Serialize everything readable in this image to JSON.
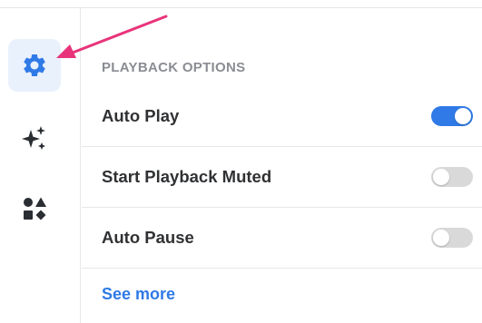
{
  "sidebar": {
    "items": [
      {
        "name": "settings",
        "icon": "gear-icon",
        "active": true
      },
      {
        "name": "effects",
        "icon": "sparkles-icon",
        "active": false
      },
      {
        "name": "shapes",
        "icon": "shapes-icon",
        "active": false
      }
    ]
  },
  "playback": {
    "section_title": "PLAYBACK OPTIONS",
    "options": [
      {
        "label": "Auto Play",
        "enabled": true
      },
      {
        "label": "Start Playback Muted",
        "enabled": false
      },
      {
        "label": "Auto Pause",
        "enabled": false
      }
    ],
    "see_more": "See more"
  },
  "colors": {
    "accent": "#2f7ae6",
    "annotation_arrow": "#e8347a",
    "active_bg": "#e9f1fd"
  }
}
